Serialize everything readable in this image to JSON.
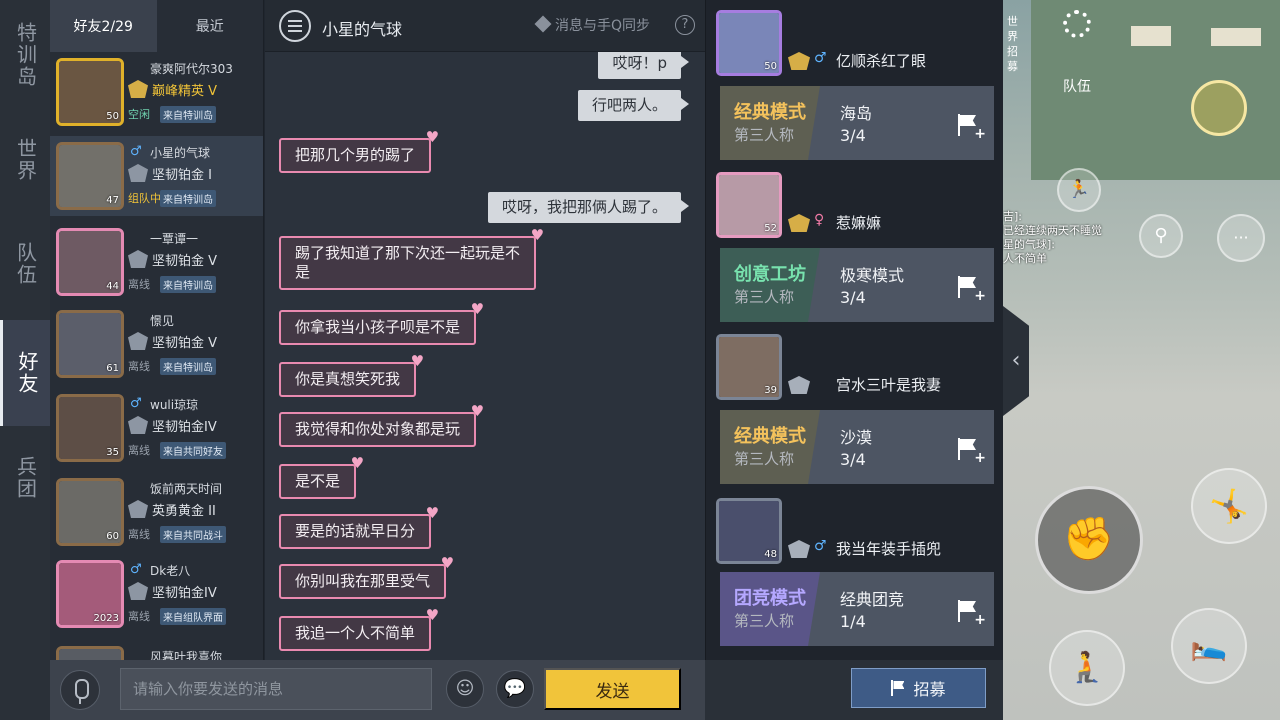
{
  "nav": {
    "items": [
      {
        "label": "特训岛",
        "active": false
      },
      {
        "label": "世界",
        "active": false
      },
      {
        "label": "队伍",
        "active": false
      },
      {
        "label": "好友",
        "active": true
      },
      {
        "label": "兵团",
        "active": false
      }
    ]
  },
  "friends": {
    "tabs": [
      {
        "label": "好友2/29",
        "active": true
      },
      {
        "label": "最近",
        "active": false
      }
    ],
    "list": [
      {
        "name": "豪爽阿代尔303",
        "gender": "",
        "rank": "巅峰精英 V",
        "status": "空闲",
        "source": "来自特训岛",
        "level": "50",
        "avatar_color": "#6a5642"
      },
      {
        "name": "小星的气球",
        "gender": "♂",
        "rank": "坚韧铂金 I",
        "status": "组队中",
        "source": "来自特训岛",
        "level": "47",
        "avatar_color": "#72706a"
      },
      {
        "name": "一覃谭一",
        "gender": "",
        "rank": "坚韧铂金 V",
        "status": "离线",
        "source": "来自特训岛",
        "level": "44",
        "avatar_color": "#6e5a63"
      },
      {
        "name": "憬见",
        "gender": "",
        "rank": "坚韧铂金 V",
        "status": "离线",
        "source": "来自特训岛",
        "level": "61",
        "avatar_color": "#5b5e6a"
      },
      {
        "name": "wuli琼琼",
        "gender": "♂",
        "rank": "坚韧铂金IV",
        "status": "离线",
        "source": "来自共同好友",
        "level": "35",
        "avatar_color": "#5d4e46"
      },
      {
        "name": "饭前两天时间",
        "gender": "",
        "rank": "英勇黄金 II",
        "status": "离线",
        "source": "来自共同战斗",
        "level": "60",
        "avatar_color": "#6b6a66"
      },
      {
        "name": "Dk老八",
        "gender": "♂",
        "rank": "坚韧铂金IV",
        "status": "离线",
        "source": "来自组队界面",
        "level": "2023",
        "avatar_color": "#a45b7a"
      },
      {
        "name": "风暮叶我喜你",
        "gender": "",
        "rank": "",
        "status": "",
        "source": "",
        "level": "",
        "avatar_color": "#585c63"
      }
    ]
  },
  "chat": {
    "title": "小星的气球",
    "sync_label": "消息与手Q同步",
    "help": "?",
    "messages": [
      {
        "dir": "out",
        "text": "哎呀！p"
      },
      {
        "dir": "out",
        "text": "行吧两人。"
      },
      {
        "dir": "in",
        "text": "把那几个男的踢了"
      },
      {
        "dir": "out",
        "text": "哎呀，我把那俩人踢了。"
      },
      {
        "dir": "in",
        "text": "踢了我知道了那下次还一起玩是不\n是"
      },
      {
        "dir": "in",
        "text": "你拿我当小孩子呗是不是"
      },
      {
        "dir": "in",
        "text": "你是真想笑死我"
      },
      {
        "dir": "in",
        "text": "我觉得和你处对象都是玩"
      },
      {
        "dir": "in",
        "text": "是不是"
      },
      {
        "dir": "in",
        "text": "要是的话就早日分"
      },
      {
        "dir": "in",
        "text": "你别叫我在那里受气"
      },
      {
        "dir": "in",
        "text": "我追一个人不简单"
      }
    ],
    "input_placeholder": "请输入你要发送的消息",
    "input_value": "",
    "send_label": "发送"
  },
  "recruit": {
    "entries": [
      {
        "name": "亿顺杀红了眼",
        "gender": "♂",
        "gender_color": "#5fb4ff",
        "level": "50",
        "mode": "经典模式",
        "mode_type": "classic",
        "view": "第三人称",
        "map": "海岛",
        "count": "3/4",
        "avatar_color": "#7a86b8"
      },
      {
        "name": "惹嫲嫲",
        "gender": "♀",
        "gender_color": "#f07aa6",
        "level": "52",
        "mode": "创意工坊",
        "mode_type": "creative",
        "view": "第三人称",
        "map": "极寒模式",
        "count": "3/4",
        "avatar_color": "#b79aa6"
      },
      {
        "name": "宫水三叶是我妻",
        "gender": "",
        "gender_color": "#5fb4ff",
        "level": "39",
        "mode": "经典模式",
        "mode_type": "classic",
        "view": "第三人称",
        "map": "沙漠",
        "count": "3/4",
        "avatar_color": "#7e6d62"
      },
      {
        "name": "我当年装手插兜",
        "gender": "♂",
        "gender_color": "#5fb4ff",
        "level": "48",
        "mode": "团竞模式",
        "mode_type": "team",
        "view": "第三人称",
        "map": "经典团竞",
        "count": "1/4",
        "avatar_color": "#4a4f6c"
      }
    ],
    "recruit_label": "招募"
  },
  "scene": {
    "world_tab": "世界招募",
    "team_label": "队伍",
    "chat_log": "吉]:\n已经连续两天不睡觉\n星的气球]:\n人不简单"
  }
}
